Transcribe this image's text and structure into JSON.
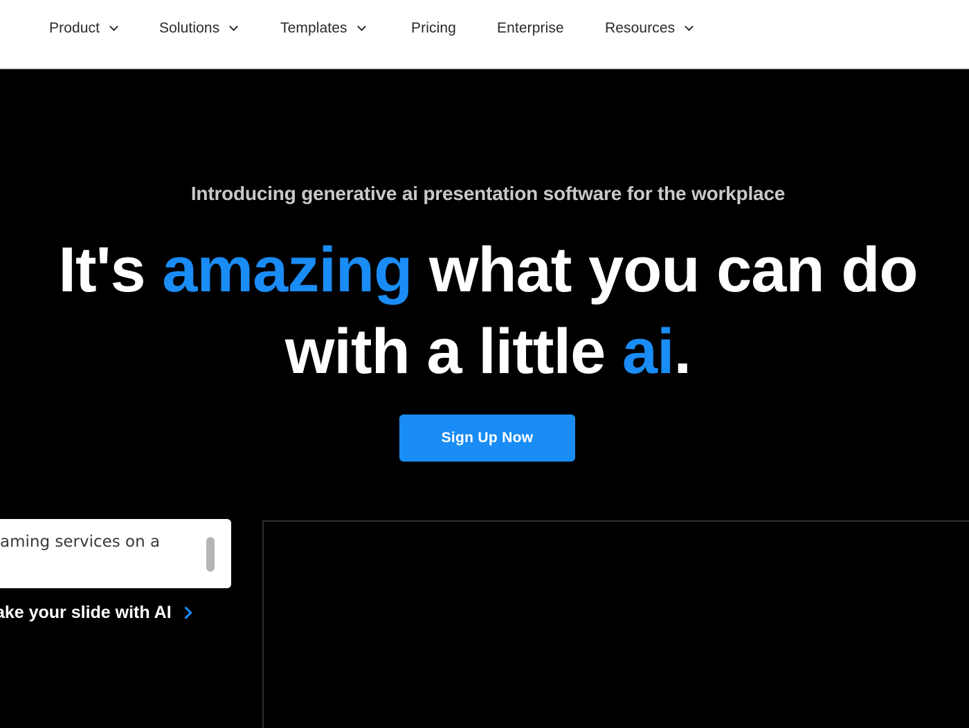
{
  "nav": {
    "items": [
      {
        "label": "Product",
        "has_dropdown": true
      },
      {
        "label": "Solutions",
        "has_dropdown": true
      },
      {
        "label": "Templates",
        "has_dropdown": true
      },
      {
        "label": "Pricing",
        "has_dropdown": false
      },
      {
        "label": "Enterprise",
        "has_dropdown": false
      },
      {
        "label": "Resources",
        "has_dropdown": true
      }
    ]
  },
  "hero": {
    "intro": "Introducing generative ai presentation software for the workplace",
    "headline": {
      "line1_pre": "It's",
      "line1_accent": "amazing",
      "line1_post": "what you can do",
      "line2_pre": "with a little",
      "line2_accent": "ai",
      "line2_post": "."
    },
    "cta_label": "Sign Up Now"
  },
  "ai_prompt": {
    "value": "aming services on a",
    "action_label": "lake your slide with AI"
  },
  "colors": {
    "accent": "#1a8cf5",
    "background": "#000000",
    "nav_background": "#ffffff"
  }
}
